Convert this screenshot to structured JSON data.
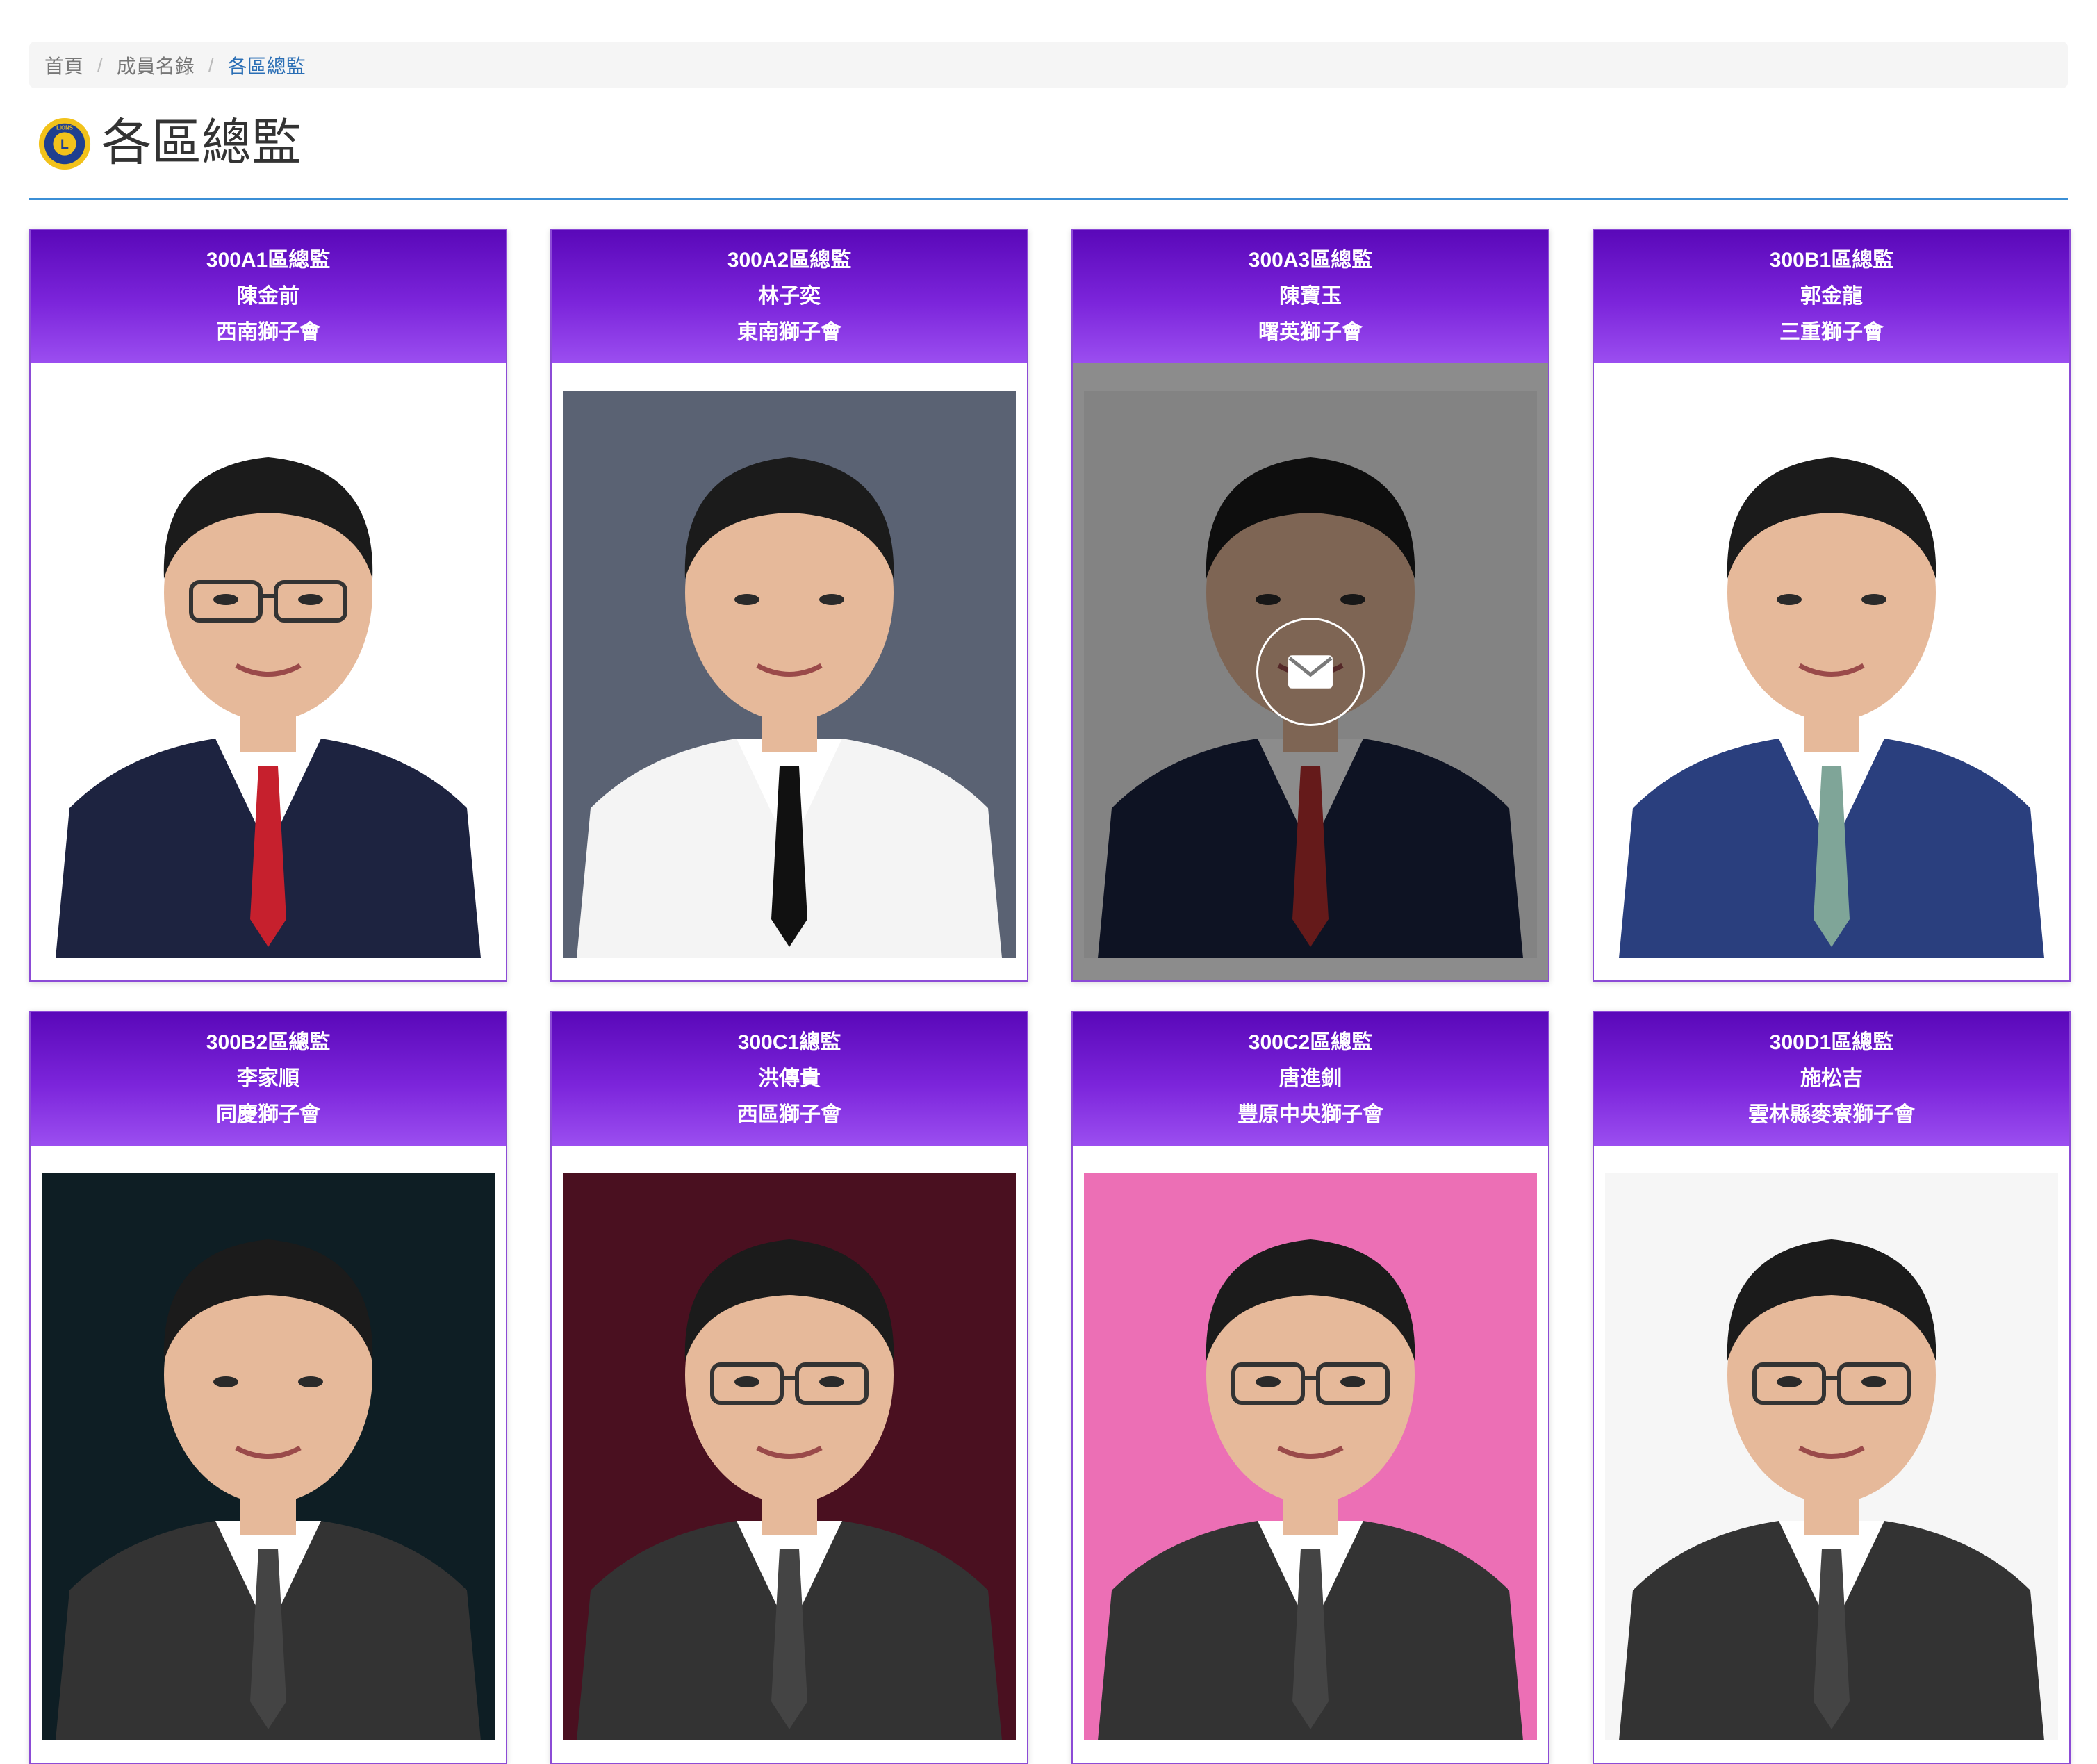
{
  "breadcrumb": {
    "items": [
      {
        "label": "首頁"
      },
      {
        "label": "成員名錄"
      },
      {
        "label": "各區總監"
      }
    ]
  },
  "page": {
    "title": "各區總監",
    "logo_text": "LIONS"
  },
  "members": [
    {
      "district": "300A1區總監",
      "name": "陳金前",
      "club": "西南獅子會",
      "photo_bg": "#ffffff",
      "suit": "#1d2340",
      "tie": "#c6202d",
      "glasses": true
    },
    {
      "district": "300A2區總監",
      "name": "林子奕",
      "club": "東南獅子會",
      "photo_bg": "#5a6273",
      "suit": "#f4f4f4",
      "tie": "#111111",
      "glasses": false
    },
    {
      "district": "300A3區總監",
      "name": "陳寶玉",
      "club": "曙英獅子會",
      "photo_bg": "#eeeeee",
      "suit": "#1b2340",
      "tie": "#b83030",
      "glasses": false,
      "hovered": true
    },
    {
      "district": "300B1區總監",
      "name": "郭金龍",
      "club": "三重獅子會",
      "photo_bg": "#ffffff",
      "suit": "#2a3f7e",
      "tie": "#7fa598",
      "glasses": false
    },
    {
      "district": "300B2區總監",
      "name": "李家順",
      "club": "同慶獅子會",
      "photo_bg": "#0e1e24",
      "suit": "#333333",
      "tie": "#444444",
      "glasses": false
    },
    {
      "district": "300C1總監",
      "name": "洪傳貴",
      "club": "西區獅子會",
      "photo_bg": "#4a1020",
      "suit": "#333333",
      "tie": "#444444",
      "glasses": true
    },
    {
      "district": "300C2區總監",
      "name": "唐進釧",
      "club": "豐原中央獅子會",
      "photo_bg": "#ec6fb5",
      "suit": "#333333",
      "tie": "#444444",
      "glasses": true
    },
    {
      "district": "300D1區總監",
      "name": "施松吉",
      "club": "雲林縣麥寮獅子會",
      "photo_bg": "#f6f6f6",
      "suit": "#333333",
      "tie": "#444444",
      "glasses": true
    }
  ]
}
